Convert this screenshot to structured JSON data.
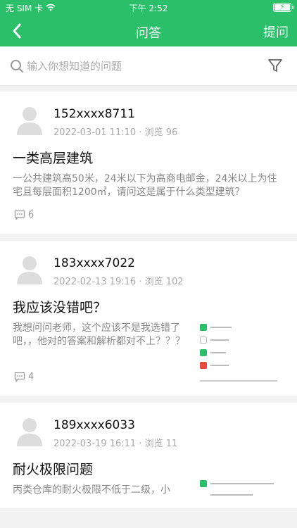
{
  "status": {
    "carrier": "无 SIM 卡",
    "time": "下午 2:52"
  },
  "nav": {
    "title": "问答",
    "action_label": "提问"
  },
  "search": {
    "placeholder": "输入你想知道的问题"
  },
  "questions": [
    {
      "user": "152xxxx8711",
      "date": "2022-03-01 11:10",
      "views_label": "浏览",
      "views": "96",
      "title": "一类高层建筑",
      "body": "一公共建筑高50米，24米以下为高商电邮金，24米以上为住宅且每层面积1200㎡，请问这是属于什么类型建筑？",
      "comments": "6"
    },
    {
      "user": "183xxxx7022",
      "date": "2022-02-13 19:16",
      "views_label": "浏览",
      "views": "102",
      "title": "我应该没错吧？",
      "body": "我想问问老师，这个应该不是我选错了吧，，他对的答案和解析都对不上？？？",
      "comments": "4"
    },
    {
      "user": "189xxxx6033",
      "date": "2022-03-19 16:11",
      "views_label": "浏览",
      "views": "11",
      "title": "耐火极限问题",
      "body": "丙类仓库的耐火极限不低于二级，小"
    }
  ],
  "colors": {
    "brand": "#2cbf6a",
    "wrong": "#e74c3c"
  }
}
